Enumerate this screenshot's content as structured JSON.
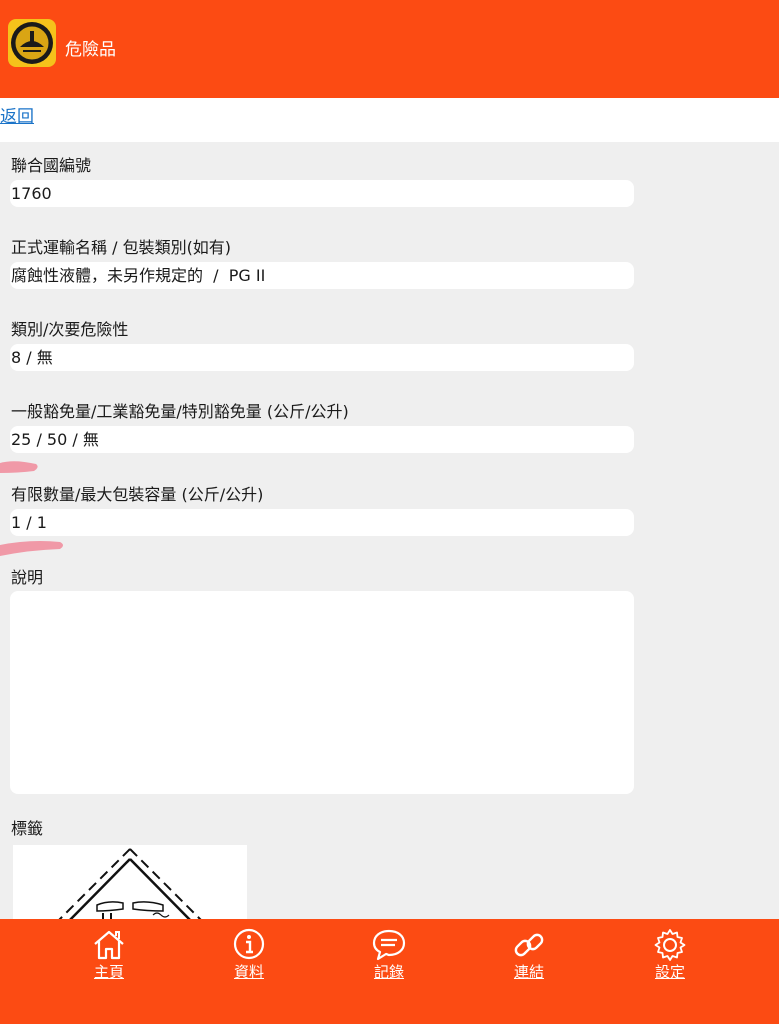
{
  "header": {
    "title": "危險品",
    "logo_icon": "safety-seal-logo"
  },
  "back": {
    "label": "返回"
  },
  "fields": [
    {
      "label": "聯合國編號",
      "value": "1760"
    },
    {
      "label": "正式運輸名稱 / 包裝類別(如有)",
      "value": "腐蝕性液體，未另作規定的  /  PG II"
    },
    {
      "label": "類別/次要危險性",
      "value": "8 / 無"
    },
    {
      "label": "一般豁免量/工業豁免量/特別豁免量 (公斤/公升)",
      "value": "25 / 50 / 無"
    },
    {
      "label": "有限數量/最大包裝容量 (公斤/公升)",
      "value": "1 / 1"
    }
  ],
  "description": {
    "label": "說明",
    "value": ""
  },
  "label_section": {
    "label": "標籤",
    "image_icon": "corrosive-hazard-label"
  },
  "nav": [
    {
      "label": "主頁",
      "icon": "home-icon"
    },
    {
      "label": "資料",
      "icon": "info-icon"
    },
    {
      "label": "記錄",
      "icon": "chat-icon"
    },
    {
      "label": "連結",
      "icon": "link-icon"
    },
    {
      "label": "設定",
      "icon": "gear-icon"
    }
  ],
  "colors": {
    "accent": "#fc4b13",
    "background": "#efefef",
    "link": "#1a73c8",
    "scribble": "#f08a9a"
  }
}
